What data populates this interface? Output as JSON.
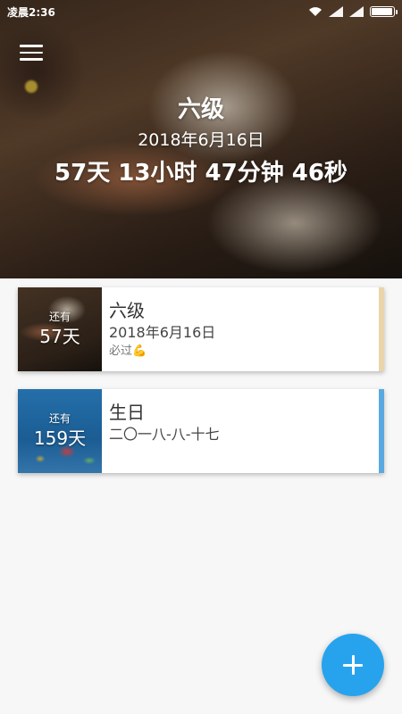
{
  "status_bar": {
    "time": "凌晨2:36",
    "battery_level": 0.9
  },
  "hero": {
    "title": "六级",
    "date": "2018年6月16日",
    "countdown": "57天 13小时 47分钟 46秒"
  },
  "events": [
    {
      "thumb_label": "还有",
      "days": "57天",
      "title": "六级",
      "date": "2018年6月16日",
      "note": "必过💪",
      "accent_color": "#ead5aa"
    },
    {
      "thumb_label": "还有",
      "days": "159天",
      "title": "生日",
      "date": "二〇一八-八-十七",
      "note": "",
      "accent_color": "#5aa9e0"
    }
  ],
  "fab": {
    "icon": "plus-icon",
    "color": "#27a3ee"
  }
}
